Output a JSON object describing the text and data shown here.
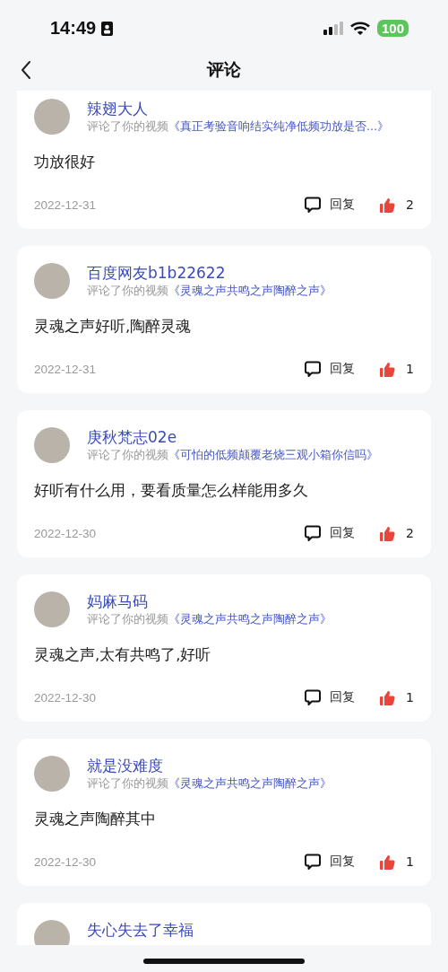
{
  "status_bar": {
    "time": "14:49",
    "battery": "100"
  },
  "nav": {
    "title": "评论"
  },
  "comments": [
    {
      "user": "辣翅大人",
      "action": "评论了你的视频",
      "video": "《真正考验音响结实纯净低频功放是否...》",
      "text": "功放很好",
      "date": "2022-12-31",
      "reply": "回复",
      "likes": "2"
    },
    {
      "user": "百度网友b1b22622",
      "action": "评论了你的视频",
      "video": "《灵魂之声共鸣之声陶醉之声》",
      "text": "灵魂之声好听,陶醉灵魂",
      "date": "2022-12-31",
      "reply": "回复",
      "likes": "1"
    },
    {
      "user": "庚秋梵志02e",
      "action": "评论了你的视频",
      "video": "《可怕的低频颠覆老烧三观小箱你信吗》",
      "text": "好听有什么用，要看质量怎么样能用多久",
      "date": "2022-12-30",
      "reply": "回复",
      "likes": "2"
    },
    {
      "user": "妈麻马码",
      "action": "评论了你的视频",
      "video": "《灵魂之声共鸣之声陶醉之声》",
      "text": "灵魂之声,太有共鸣了,好听",
      "date": "2022-12-30",
      "reply": "回复",
      "likes": "1"
    },
    {
      "user": "就是没难度",
      "action": "评论了你的视频",
      "video": "《灵魂之声共鸣之声陶醉之声》",
      "text": "灵魂之声陶醉其中",
      "date": "2022-12-30",
      "reply": "回复",
      "likes": "1"
    },
    {
      "user": "失心失去了幸福"
    }
  ]
}
